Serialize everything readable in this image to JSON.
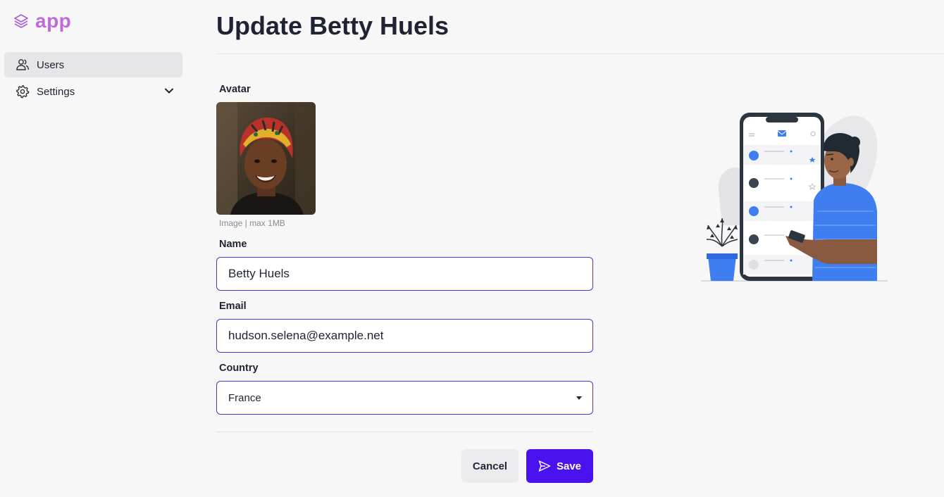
{
  "app": {
    "logo_text": "app",
    "brand_color": "#c06ad8"
  },
  "sidebar": {
    "items": [
      {
        "label": "Users",
        "icon": "users-icon",
        "active": true
      },
      {
        "label": "Settings",
        "icon": "gear-icon",
        "expandable": true
      }
    ]
  },
  "page": {
    "title": "Update Betty Huels"
  },
  "form": {
    "avatar": {
      "label": "Avatar",
      "hint": "Image | max 1MB"
    },
    "name": {
      "label": "Name",
      "value": "Betty Huels"
    },
    "email": {
      "label": "Email",
      "value": "hudson.selena@example.net"
    },
    "country": {
      "label": "Country",
      "value": "France"
    }
  },
  "actions": {
    "cancel_label": "Cancel",
    "save_label": "Save"
  },
  "colors": {
    "accent": "#4a12ee",
    "field_border": "#5b2bd6",
    "illustration_blue": "#3f7ef0"
  }
}
